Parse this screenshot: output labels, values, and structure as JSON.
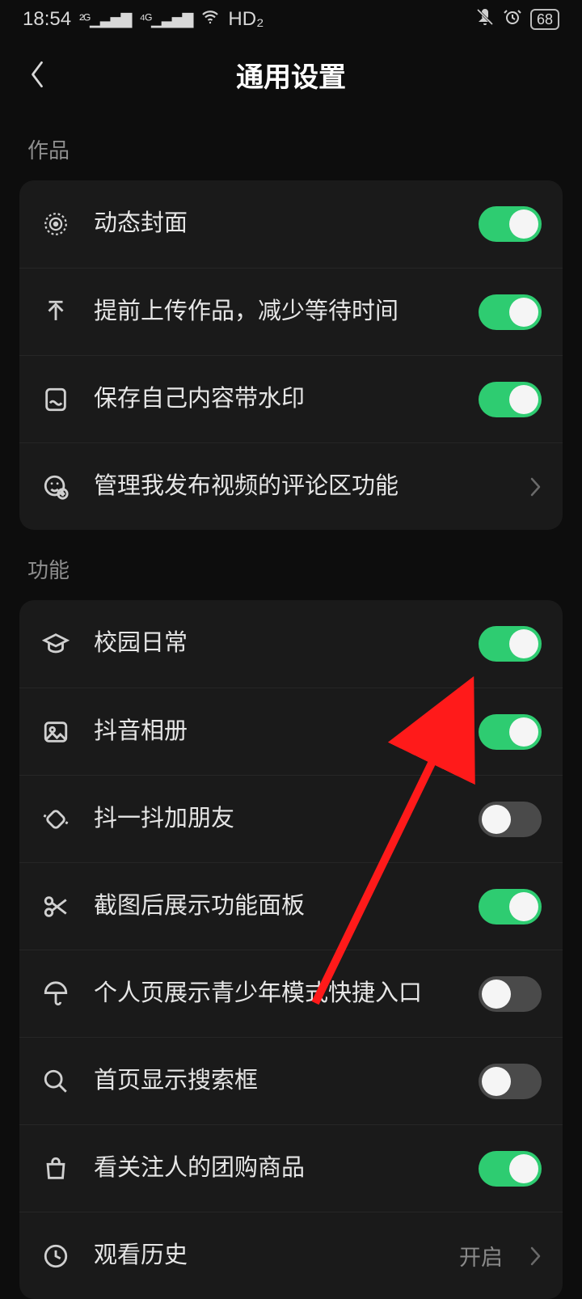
{
  "status": {
    "time": "18:54",
    "net2g": "2G",
    "net4g": "4G",
    "wifi": true,
    "hd": "HD₂",
    "battery": "68"
  },
  "header": {
    "title": "通用设置"
  },
  "sections": [
    {
      "title": "作品",
      "items": [
        {
          "icon": "target",
          "label": "动态封面",
          "type": "toggle",
          "on": true
        },
        {
          "icon": "upload",
          "label": "提前上传作品，减少等待时间",
          "type": "toggle",
          "on": true
        },
        {
          "icon": "photo-wave",
          "label": "保存自己内容带水印",
          "type": "toggle",
          "on": true
        },
        {
          "icon": "face-gear",
          "label": "管理我发布视频的评论区功能",
          "type": "link"
        }
      ]
    },
    {
      "title": "功能",
      "items": [
        {
          "icon": "cap",
          "label": "校园日常",
          "type": "toggle",
          "on": true
        },
        {
          "icon": "photo",
          "label": "抖音相册",
          "type": "toggle",
          "on": true
        },
        {
          "icon": "shake",
          "label": "抖一抖加朋友",
          "type": "toggle",
          "on": false
        },
        {
          "icon": "scissors",
          "label": "截图后展示功能面板",
          "type": "toggle",
          "on": true
        },
        {
          "icon": "umbrella",
          "label": "个人页展示青少年模式快捷入口",
          "type": "toggle",
          "on": false
        },
        {
          "icon": "search",
          "label": "首页显示搜索框",
          "type": "toggle",
          "on": false
        },
        {
          "icon": "bag",
          "label": "看关注人的团购商品",
          "type": "toggle",
          "on": true
        },
        {
          "icon": "clock",
          "label": "观看历史",
          "type": "link",
          "value": "开启"
        }
      ]
    }
  ]
}
